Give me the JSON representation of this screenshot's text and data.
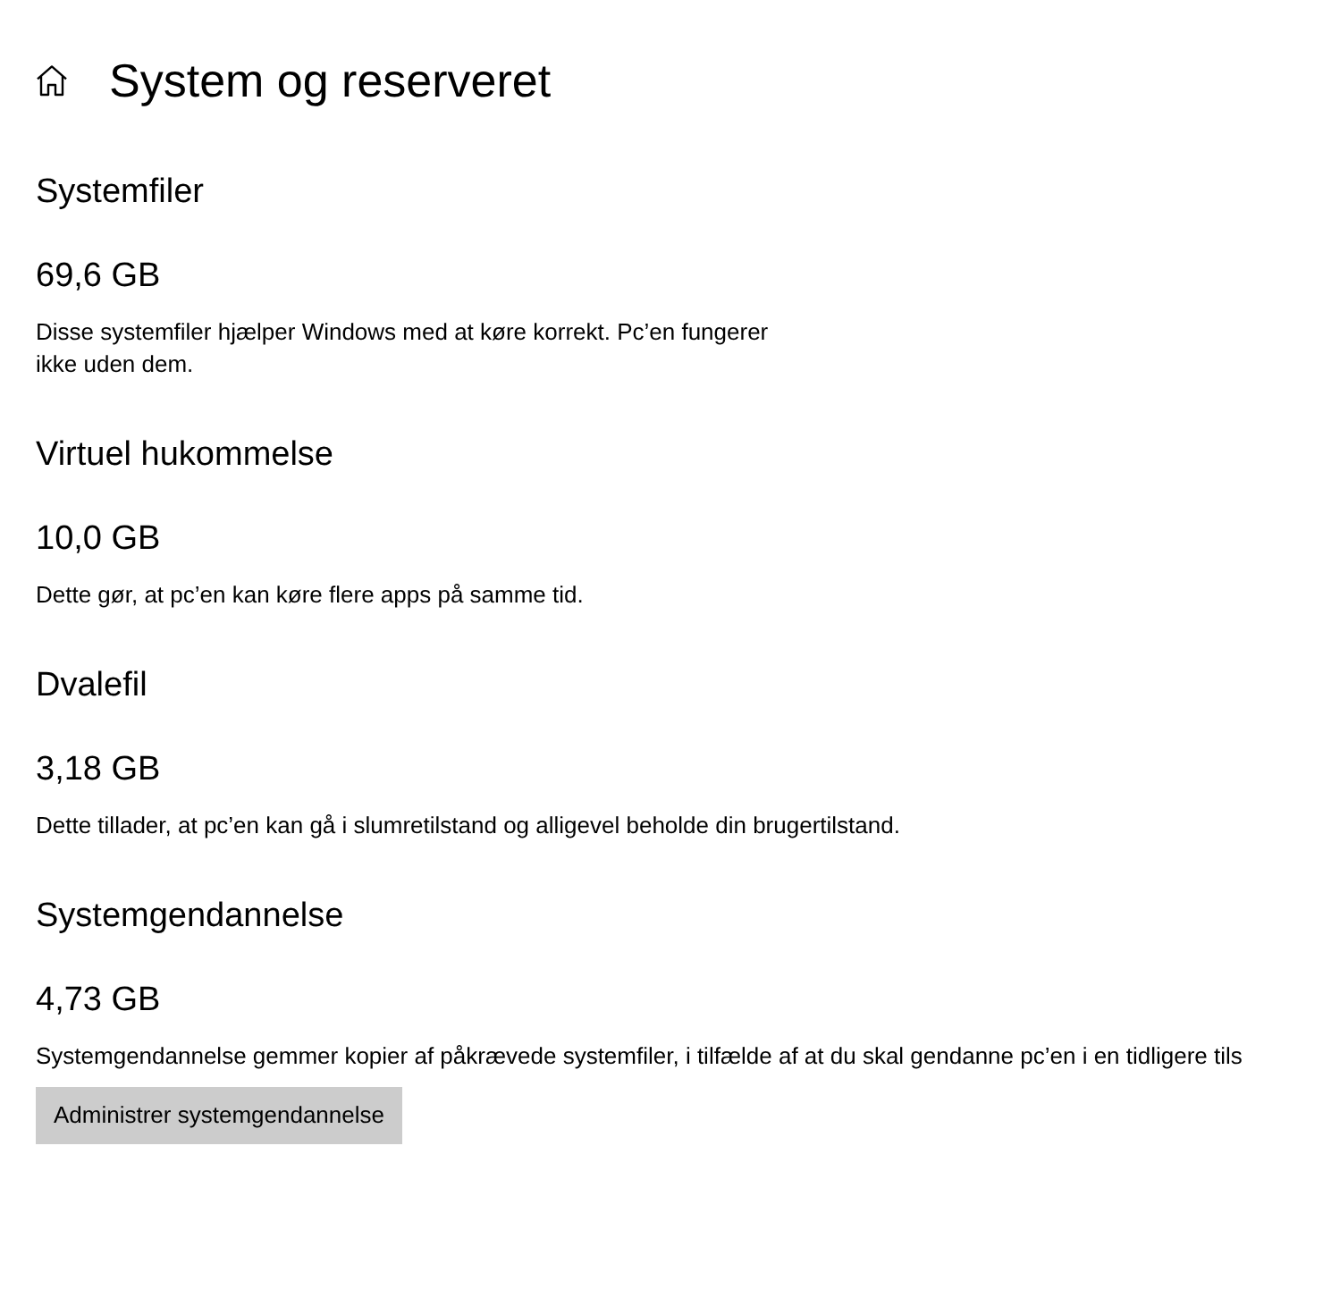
{
  "page": {
    "title": "System og reserveret"
  },
  "sections": [
    {
      "heading": "Systemfiler",
      "size": "69,6 GB",
      "description": "Disse systemfiler hjælper Windows med at køre korrekt. Pc’en fungerer ikke uden dem."
    },
    {
      "heading": "Virtuel hukommelse",
      "size": "10,0 GB",
      "description": "Dette gør, at pc’en kan køre flere apps på samme tid."
    },
    {
      "heading": "Dvalefil",
      "size": "3,18 GB",
      "description": "Dette tillader, at pc’en kan gå i slumretilstand og alligevel beholde din brugertilstand."
    },
    {
      "heading": "Systemgendannelse",
      "size": "4,73 GB",
      "description": "Systemgendannelse gemmer kopier af påkrævede systemfiler, i tilfælde af at du skal gendanne pc’en i en tidligere tils",
      "button": "Administrer systemgendannelse"
    }
  ]
}
